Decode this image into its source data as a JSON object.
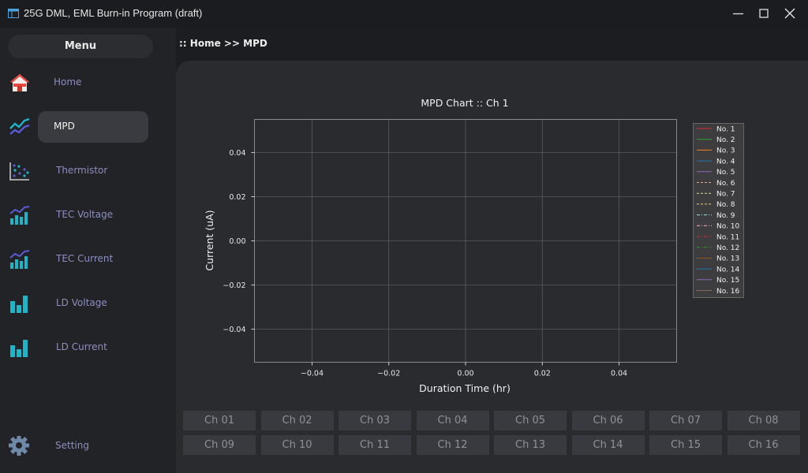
{
  "window": {
    "title": "25G DML, EML Burn-in Program (draft)",
    "app_icon": "window-app-icon",
    "controls": [
      "minimize-icon",
      "maximize-icon",
      "close-icon"
    ]
  },
  "sidebar": {
    "menu_label": "Menu",
    "items": [
      {
        "label": "Home",
        "icon": "home-icon"
      },
      {
        "label": "MPD",
        "icon": "trend-line-icon",
        "active": true
      },
      {
        "label": "Thermistor",
        "icon": "scatter-icon"
      },
      {
        "label": "TEC Voltage",
        "icon": "bar-trend-icon"
      },
      {
        "label": "TEC Current",
        "icon": "bar-trend-icon"
      },
      {
        "label": "LD Voltage",
        "icon": "bar-chart-icon"
      },
      {
        "label": "LD Current",
        "icon": "bar-chart-icon"
      }
    ],
    "setting": {
      "label": "Setting",
      "icon": "gear-icon"
    }
  },
  "breadcrumb": ":: Home >> MPD",
  "chart_data": {
    "type": "line",
    "title": "MPD Chart :: Ch 1",
    "xlabel": "Duration Time (hr)",
    "ylabel": "Current (uA)",
    "xlim": [
      -0.055,
      0.055
    ],
    "ylim": [
      -0.055,
      0.055
    ],
    "xticks": [
      -0.04,
      -0.02,
      0.0,
      0.02,
      0.04
    ],
    "yticks": [
      -0.04,
      -0.02,
      0.0,
      0.02,
      0.04
    ],
    "xtick_labels": [
      "−0.04",
      "−0.02",
      "0.00",
      "0.02",
      "0.04"
    ],
    "ytick_labels": [
      "−0.04",
      "−0.02",
      "0.00",
      "0.02",
      "0.04"
    ],
    "grid": true,
    "legend_position": "upper-right-outside",
    "series": [
      {
        "name": "No. 1",
        "color": "#d62728",
        "dash": "solid",
        "values": []
      },
      {
        "name": "No. 2",
        "color": "#2ca02c",
        "dash": "solid",
        "values": []
      },
      {
        "name": "No. 3",
        "color": "#ff7f0e",
        "dash": "solid",
        "values": []
      },
      {
        "name": "No. 4",
        "color": "#1f77b4",
        "dash": "solid",
        "values": []
      },
      {
        "name": "No. 5",
        "color": "#9467bd",
        "dash": "solid",
        "values": []
      },
      {
        "name": "No. 6",
        "color": "#e6a88a",
        "dash": "dash",
        "values": []
      },
      {
        "name": "No. 7",
        "color": "#dbdb8d",
        "dash": "dash",
        "values": []
      },
      {
        "name": "No. 8",
        "color": "#f0c674",
        "dash": "dash",
        "values": []
      },
      {
        "name": "No. 9",
        "color": "#9edae5",
        "dash": "dashdot",
        "values": []
      },
      {
        "name": "No. 10",
        "color": "#f7b6d2",
        "dash": "dashdot",
        "values": []
      },
      {
        "name": "No. 11",
        "color": "#d62728",
        "dash": "dashdot",
        "values": []
      },
      {
        "name": "No. 12",
        "color": "#2ca02c",
        "dash": "dashdot",
        "values": []
      },
      {
        "name": "No. 13",
        "color": "#ff7f0e",
        "dash": "dot",
        "values": []
      },
      {
        "name": "No. 14",
        "color": "#1f77b4",
        "dash": "solid",
        "values": []
      },
      {
        "name": "No. 15",
        "color": "#9467bd",
        "dash": "solid",
        "values": []
      },
      {
        "name": "No. 16",
        "color": "#e6a88a",
        "dash": "dot",
        "values": []
      }
    ]
  },
  "channels": [
    "Ch 01",
    "Ch 02",
    "Ch 03",
    "Ch 04",
    "Ch 05",
    "Ch 06",
    "Ch 07",
    "Ch 08",
    "Ch 09",
    "Ch 10",
    "Ch 11",
    "Ch 12",
    "Ch 13",
    "Ch 14",
    "Ch 15",
    "Ch 16"
  ],
  "colors": {
    "accent_icon": "#1fb5c9",
    "accent_icon_secondary": "#5b5bd6",
    "sidebar_label": "#8b8ec0",
    "panel_bg": "#2a2b2f",
    "button_bg": "#393a3f"
  }
}
